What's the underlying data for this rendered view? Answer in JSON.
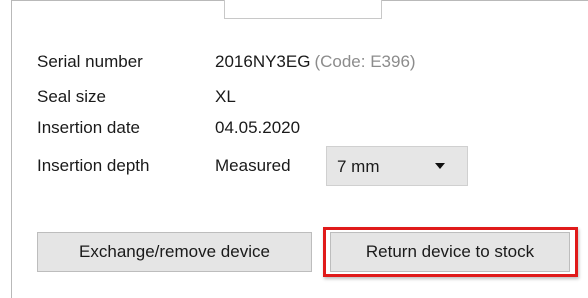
{
  "fields": {
    "serial_number": {
      "label": "Serial number",
      "value": "2016NY3EG",
      "code": "(Code: E396)"
    },
    "seal_size": {
      "label": "Seal size",
      "value": "XL"
    },
    "insertion_date": {
      "label": "Insertion date",
      "value": "04.05.2020"
    },
    "insertion_depth": {
      "label": "Insertion depth",
      "mode": "Measured",
      "selected": "7 mm"
    }
  },
  "actions": {
    "exchange_label": "Exchange/remove device",
    "return_label": "Return device to stock"
  },
  "colors": {
    "highlight": "#e01a1a",
    "code_hint": "#8c8c8c",
    "button_bg": "#e5e5e5"
  }
}
